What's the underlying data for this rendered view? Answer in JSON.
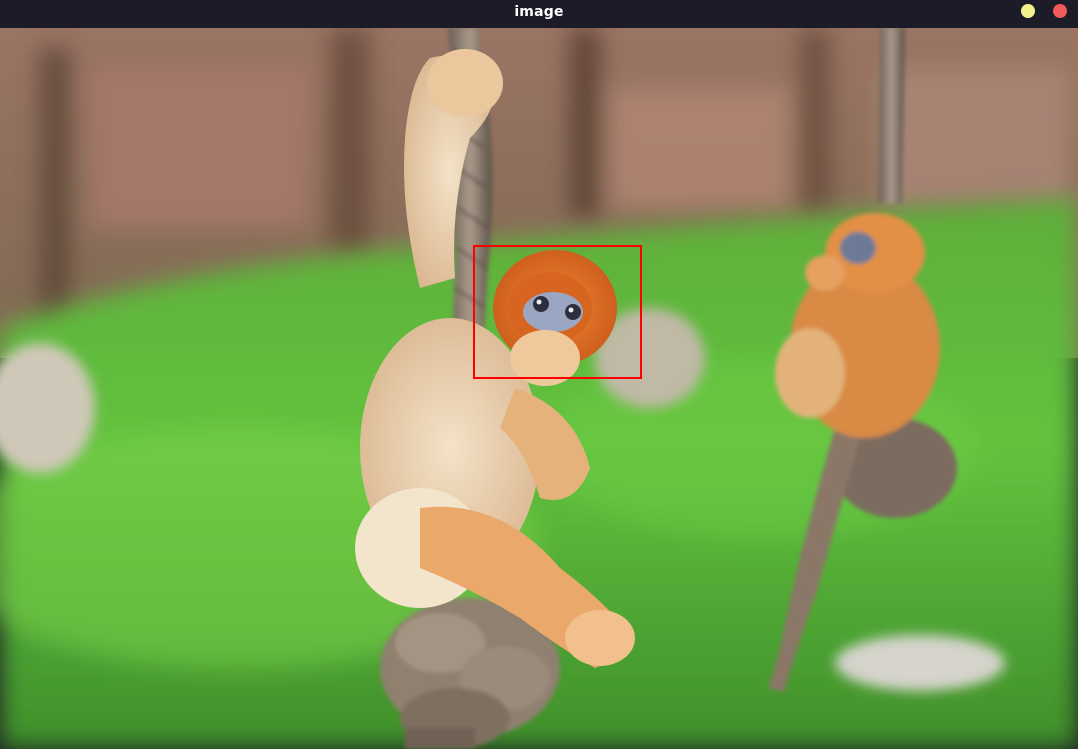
{
  "window": {
    "title": "image",
    "controls": {
      "minimize_color": "#f2f28a",
      "close_color": "#f05a5a"
    }
  },
  "viewer": {
    "annotation_color": "#ff0000",
    "icons": [
      "minimize-icon",
      "close-icon"
    ]
  }
}
